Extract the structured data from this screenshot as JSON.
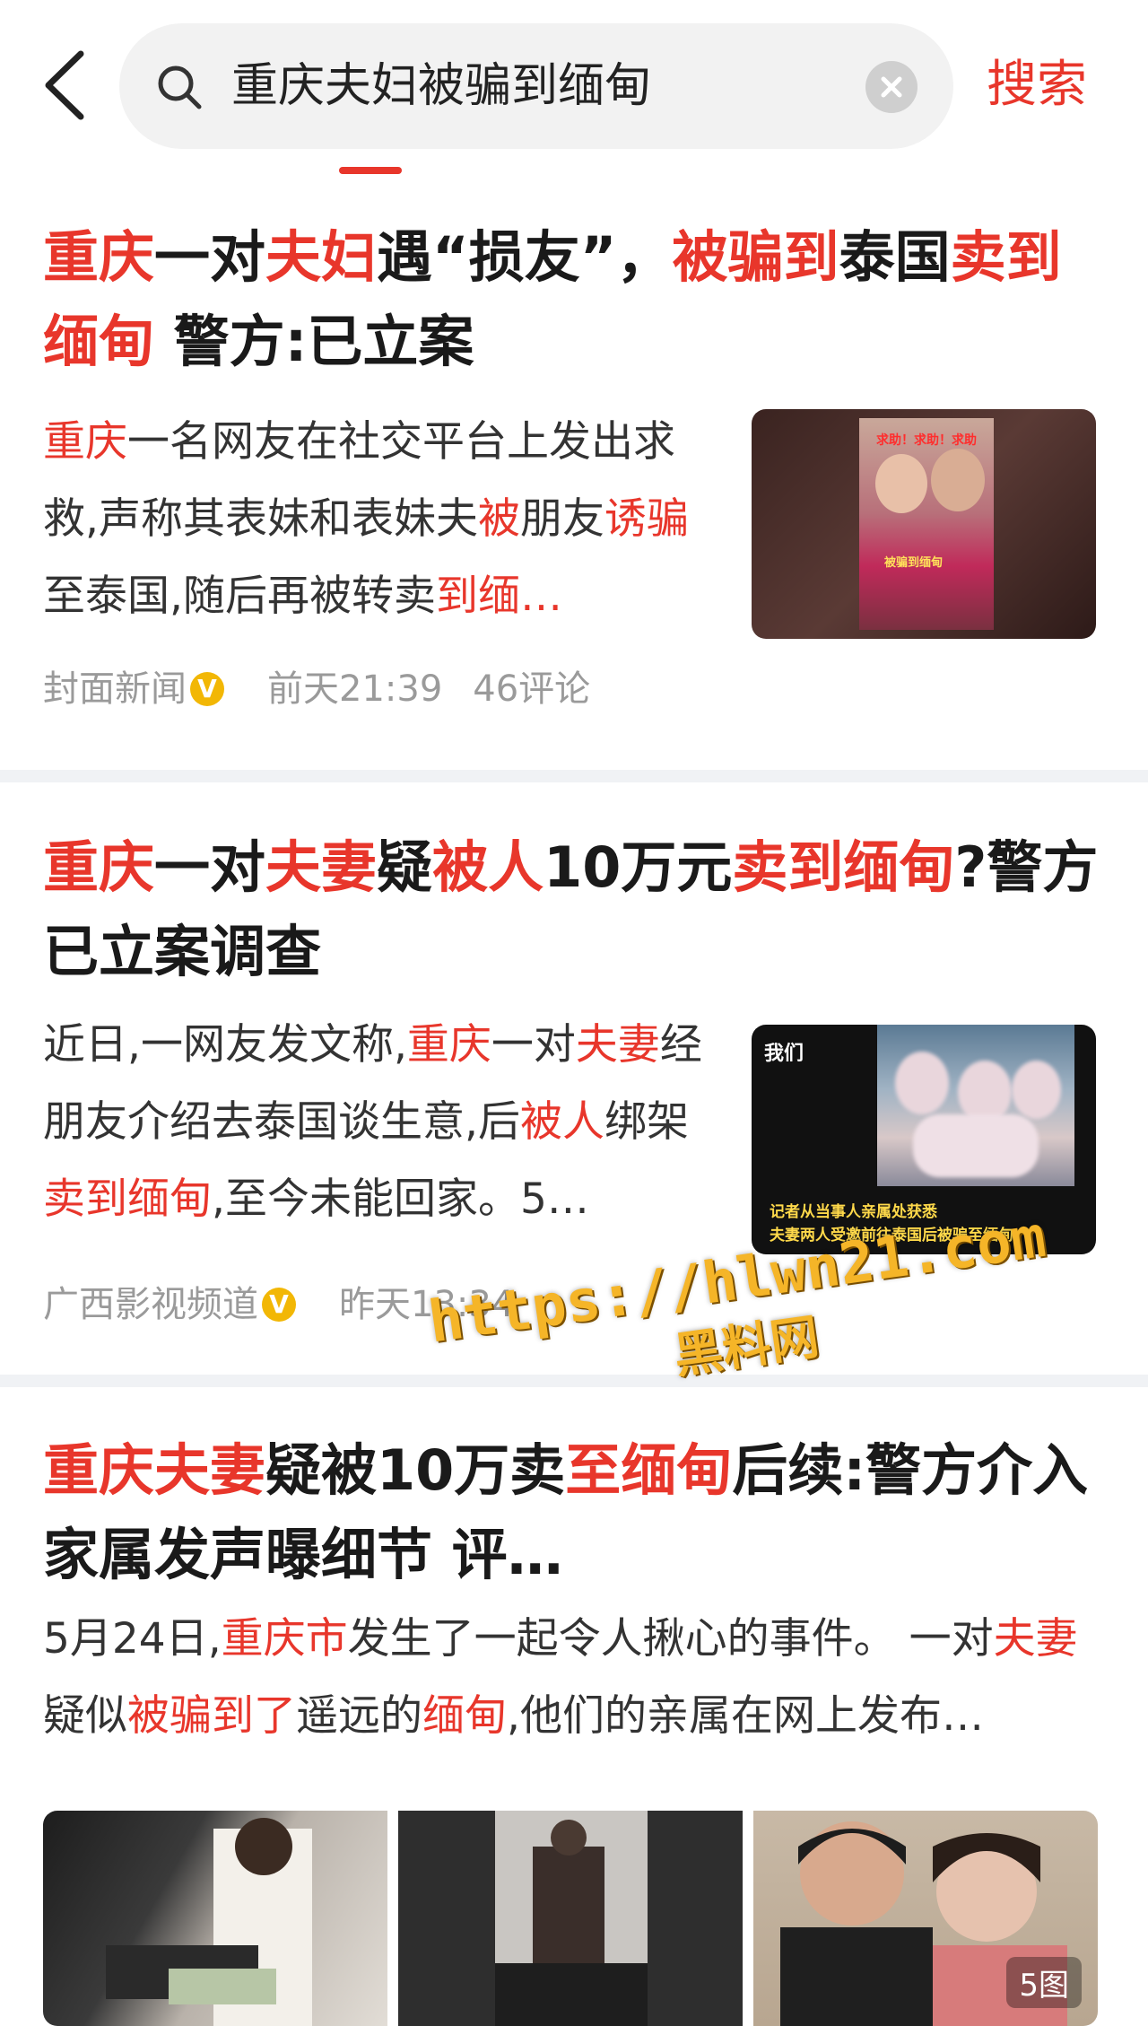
{
  "search": {
    "query": "重庆夫妇被骗到缅甸",
    "submit_label": "搜索"
  },
  "colors": {
    "highlight": "#e8362b",
    "meta_gray": "#9a9a9a",
    "verified": "#f2b705"
  },
  "items": [
    {
      "title": [
        {
          "t": "重庆",
          "hl": true
        },
        {
          "t": "一对",
          "hl": false
        },
        {
          "t": "夫妇",
          "hl": true
        },
        {
          "t": "遇“损友”，",
          "hl": false
        },
        {
          "t": "被骗到",
          "hl": true
        },
        {
          "t": "泰国",
          "hl": false
        },
        {
          "t": "卖到缅甸",
          "hl": true
        },
        {
          "t": " 警方:已立案",
          "hl": false
        }
      ],
      "summary": [
        {
          "t": "重庆",
          "hl": true
        },
        {
          "t": "一名网友在社交平台上发出求救,声称其表妹和表妹夫",
          "hl": false
        },
        {
          "t": "被",
          "hl": true
        },
        {
          "t": "朋友",
          "hl": false
        },
        {
          "t": "诱骗",
          "hl": true
        },
        {
          "t": "至泰国,随后再被转卖",
          "hl": false
        },
        {
          "t": "到缅…",
          "hl": true
        }
      ],
      "source": "封面新闻",
      "time": "前天21:39",
      "comments": "46评论",
      "thumb_caption_top": "求助！求助！求助",
      "thumb_caption_mid": "被骗到缅甸"
    },
    {
      "title": [
        {
          "t": "重庆",
          "hl": true
        },
        {
          "t": "一对",
          "hl": false
        },
        {
          "t": "夫妻",
          "hl": true
        },
        {
          "t": "疑",
          "hl": false
        },
        {
          "t": "被人",
          "hl": true
        },
        {
          "t": "10万元",
          "hl": false
        },
        {
          "t": "卖到缅甸",
          "hl": true
        },
        {
          "t": "?警方已立案调查",
          "hl": false
        }
      ],
      "summary": [
        {
          "t": "近日,一网友发文称,",
          "hl": false
        },
        {
          "t": "重庆",
          "hl": true
        },
        {
          "t": "一对",
          "hl": false
        },
        {
          "t": "夫妻",
          "hl": true
        },
        {
          "t": "经朋友介绍去泰国谈生意,后",
          "hl": false
        },
        {
          "t": "被人",
          "hl": true
        },
        {
          "t": "绑架",
          "hl": false
        },
        {
          "t": "卖到缅甸",
          "hl": true
        },
        {
          "t": ",至今未能回家。5…",
          "hl": false
        }
      ],
      "source": "广西影视频道",
      "time": "昨天13:34",
      "thumb_tag": "我们",
      "thumb_caption_1": "记者从当事人亲属处获悉",
      "thumb_caption_2": "夫妻两人受邀前往泰国后被骗至缅甸"
    },
    {
      "title": [
        {
          "t": "重庆夫妻",
          "hl": true
        },
        {
          "t": "疑被10万卖",
          "hl": false
        },
        {
          "t": "至缅甸",
          "hl": true
        },
        {
          "t": "后续:警方介入 家属发声曝细节 评…",
          "hl": false
        }
      ],
      "summary": [
        {
          "t": "5月24日,",
          "hl": false
        },
        {
          "t": "重庆市",
          "hl": true
        },
        {
          "t": "发生了一起令人揪心的事件。 一对",
          "hl": false
        },
        {
          "t": "夫妻",
          "hl": true
        },
        {
          "t": "疑似",
          "hl": false
        },
        {
          "t": "被骗到了",
          "hl": true
        },
        {
          "t": "遥远的",
          "hl": false
        },
        {
          "t": "缅甸",
          "hl": true
        },
        {
          "t": ",他们的亲属在网上发布…",
          "hl": false
        }
      ],
      "image_count": "5图"
    }
  ],
  "watermark": {
    "line1": "https://hlwn21.com",
    "line2": "黑料网"
  }
}
